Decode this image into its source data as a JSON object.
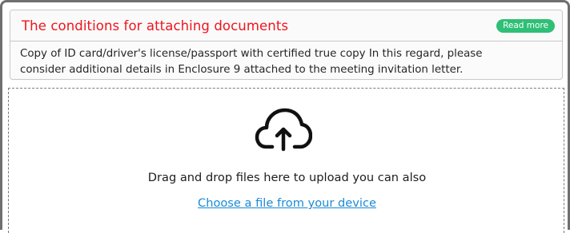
{
  "conditions": {
    "title": "The conditions for attaching documents",
    "read_more_label": "Read more",
    "description_line1": "Copy of ID card/driver's license/passport with certified true copy In this regard, please",
    "description_line2": "consider additional details in Enclosure 9 attached to the meeting invitation letter."
  },
  "upload": {
    "icon": "cloud-upload-icon",
    "drag_text": "Drag and drop files here to upload you can also",
    "choose_link": "Choose a file from your device"
  },
  "colors": {
    "title": "#f0141c",
    "read_more_bg": "#2fbf76",
    "link": "#1a8ad6"
  }
}
